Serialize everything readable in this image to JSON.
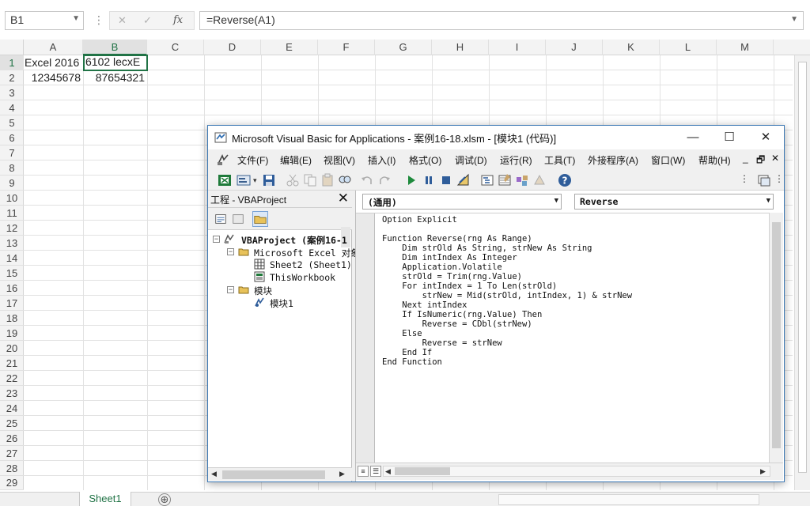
{
  "excel": {
    "name_box": "B1",
    "formula": "=Reverse(A1)",
    "fx_label": "fx",
    "columns": [
      "A",
      "B",
      "C",
      "D",
      "E",
      "F",
      "G",
      "H",
      "I",
      "J",
      "K",
      "L",
      "M"
    ],
    "rows": [
      "1",
      "2",
      "3",
      "4",
      "5",
      "6",
      "7",
      "8",
      "9",
      "10",
      "11",
      "12",
      "13",
      "14",
      "15",
      "16",
      "17",
      "18",
      "19",
      "20",
      "21",
      "22",
      "23",
      "24",
      "25",
      "26",
      "27",
      "28",
      "29"
    ],
    "cells": {
      "A1": "Excel 2016",
      "B1": "6102 lecxE",
      "A2": "12345678",
      "B2": "87654321"
    },
    "sheet_tab": "Sheet1",
    "add_sheet": "⊕"
  },
  "vbe": {
    "title": "Microsoft Visual Basic for Applications - 案例16-18.xlsm - [模块1 (代码)]",
    "window_buttons": {
      "minimize": "—",
      "maximize": "☐",
      "close": "✕"
    },
    "menu": [
      "文件(F)",
      "编辑(E)",
      "视图(V)",
      "插入(I)",
      "格式(O)",
      "调试(D)",
      "运行(R)",
      "工具(T)",
      "外接程序(A)",
      "窗口(W)",
      "帮助(H)"
    ],
    "mdi_buttons": {
      "minimize": "_",
      "restore": "🗗",
      "close": "✕"
    },
    "project": {
      "header": "工程 - VBAProject",
      "close": "✕",
      "tree": [
        {
          "label": "VBAProject (案例16-1",
          "level": 0,
          "expander": "−",
          "bold": true
        },
        {
          "label": "Microsoft Excel 对象",
          "level": 1,
          "expander": "−"
        },
        {
          "label": "Sheet2 (Sheet1)",
          "level": 2
        },
        {
          "label": "ThisWorkbook",
          "level": 2
        },
        {
          "label": "模块",
          "level": 1,
          "expander": "−"
        },
        {
          "label": "模块1",
          "level": 2
        }
      ]
    },
    "code": {
      "object_combo": "(通用)",
      "proc_combo": "Reverse",
      "lines": [
        "Option Explicit",
        "",
        "Function Reverse(rng As Range)",
        "    Dim strOld As String, strNew As String",
        "    Dim intIndex As Integer",
        "    Application.Volatile",
        "    strOld = Trim(rng.Value)",
        "    For intIndex = 1 To Len(strOld)",
        "        strNew = Mid(strOld, intIndex, 1) & strNew",
        "    Next intIndex",
        "    If IsNumeric(rng.Value) Then",
        "        Reverse = CDbl(strNew)",
        "    Else",
        "        Reverse = strNew",
        "    End If",
        "End Function"
      ]
    }
  },
  "colors": {
    "excel_accent": "#217346",
    "vbe_border": "#3c78b4"
  }
}
